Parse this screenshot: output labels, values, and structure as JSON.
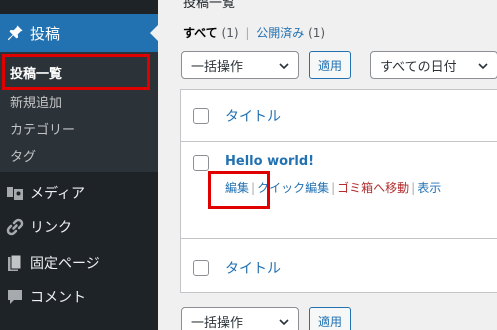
{
  "sidebar": {
    "posts_label": "投稿",
    "submenu": [
      "投稿一覧",
      "新規追加",
      "カテゴリー",
      "タグ"
    ],
    "items": [
      "メディア",
      "リンク",
      "固定ページ",
      "コメント"
    ]
  },
  "main": {
    "header_cut": "投稿一覧",
    "filters": {
      "all": "すべて",
      "all_count": "(1)",
      "published": "公開済み",
      "published_count": "(1)"
    },
    "bulk_action": "一括操作",
    "apply": "適用",
    "date_filter": "すべての日付",
    "column_title": "タイトル",
    "post": {
      "title": "Hello world!",
      "actions": {
        "edit": "編集",
        "quick_edit": "クイック編集",
        "trash": "ゴミ箱へ移動",
        "view": "表示"
      }
    }
  },
  "colors": {
    "sidebar": "#1d2327",
    "submenu": "#2c3338",
    "accent": "#2271b1",
    "highlight": "#e00000",
    "trash": "#b32d2e"
  }
}
